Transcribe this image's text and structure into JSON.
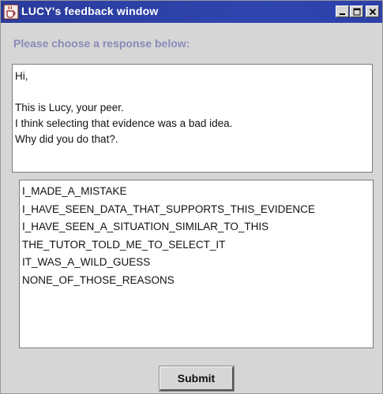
{
  "window": {
    "title": "LUCY's feedback window",
    "icon": "coffee-cup-icon",
    "controls": [
      "minimize-icon",
      "maximize-icon",
      "close-icon"
    ]
  },
  "prompt": "Please choose a response below:",
  "message": {
    "lines": [
      "Hi,",
      "",
      "This is Lucy, your peer.",
      "I think selecting that evidence was a bad idea.",
      "Why did you do that?."
    ]
  },
  "responses": [
    "I_MADE_A_MISTAKE",
    "I_HAVE_SEEN_DATA_THAT_SUPPORTS_THIS_EVIDENCE",
    "I_HAVE_SEEN_A_SITUATION_SIMILAR_TO_THIS",
    "THE_TUTOR_TOLD_ME_TO_SELECT_IT",
    "IT_WAS_A_WILD_GUESS",
    "NONE_OF_THOSE_REASONS"
  ],
  "submit_label": "Submit",
  "colors": {
    "titlebar": "#2f45b0",
    "prompt": "#8a8bb8",
    "panel": "#d6d6d6"
  }
}
